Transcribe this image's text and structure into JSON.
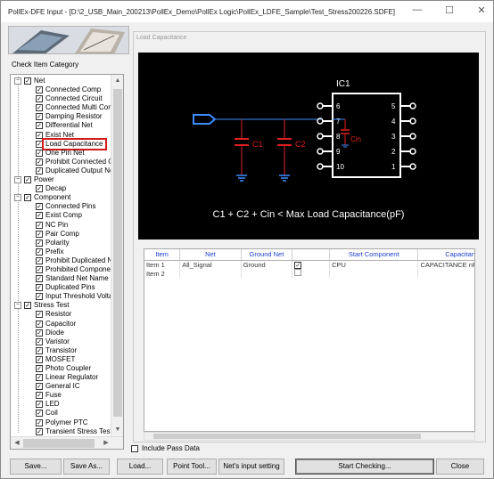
{
  "window": {
    "title": "PollEx-DFE Input - [D:\\2_USB_Main_200213\\PollEx_Demo\\PollEx Logic\\PollEx_LDFE_Sample\\Test_Stress200226.SDFE]",
    "minimize": "—",
    "maximize": "☐",
    "close": "✕"
  },
  "left_panel": {
    "category_label": "Check Item Category",
    "tree": [
      {
        "type": "group",
        "label": "Net",
        "checked": true
      },
      {
        "type": "item",
        "label": "Connected Comp",
        "checked": true
      },
      {
        "type": "item",
        "label": "Connected Circuit",
        "checked": true
      },
      {
        "type": "item",
        "label": "Connected Multi Comp",
        "checked": true
      },
      {
        "type": "item",
        "label": "Damping Resistor",
        "checked": true
      },
      {
        "type": "item",
        "label": "Differential Net",
        "checked": true
      },
      {
        "type": "item",
        "label": "Exist Net",
        "checked": true
      },
      {
        "type": "item",
        "label": "Load Capacitance",
        "checked": true,
        "selected": true
      },
      {
        "type": "item",
        "label": "One Pin Net",
        "checked": true
      },
      {
        "type": "item",
        "label": "Prohibit Connected Comp",
        "checked": true
      },
      {
        "type": "item",
        "label": "Duplicated Output Net",
        "checked": true
      },
      {
        "type": "group",
        "label": "Power",
        "checked": true
      },
      {
        "type": "item",
        "label": "Decap",
        "checked": true
      },
      {
        "type": "group",
        "label": "Component",
        "checked": true
      },
      {
        "type": "item",
        "label": "Connected Pins",
        "checked": true
      },
      {
        "type": "item",
        "label": "Exist Comp",
        "checked": true
      },
      {
        "type": "item",
        "label": "NC Pin",
        "checked": true
      },
      {
        "type": "item",
        "label": "Pair Comp",
        "checked": true
      },
      {
        "type": "item",
        "label": "Polarity",
        "checked": true
      },
      {
        "type": "item",
        "label": "Prefix",
        "checked": true
      },
      {
        "type": "item",
        "label": "Prohibit Duplicated Net",
        "checked": true
      },
      {
        "type": "item",
        "label": "Prohibited Component",
        "checked": true
      },
      {
        "type": "item",
        "label": "Standard Net Name",
        "checked": true
      },
      {
        "type": "item",
        "label": "Duplicated Pins",
        "checked": true
      },
      {
        "type": "item",
        "label": "Input Threshold Voltage",
        "checked": true
      },
      {
        "type": "group",
        "label": "Stress Test",
        "checked": true
      },
      {
        "type": "item",
        "label": "Resistor",
        "checked": true
      },
      {
        "type": "item",
        "label": "Capacitor",
        "checked": true
      },
      {
        "type": "item",
        "label": "Diode",
        "checked": true
      },
      {
        "type": "item",
        "label": "Varistor",
        "checked": true
      },
      {
        "type": "item",
        "label": "Transistor",
        "checked": true
      },
      {
        "type": "item",
        "label": "MOSFET",
        "checked": true
      },
      {
        "type": "item",
        "label": "Photo Coupler",
        "checked": true
      },
      {
        "type": "item",
        "label": "Linear Regulator",
        "checked": true
      },
      {
        "type": "item",
        "label": "General IC",
        "checked": true
      },
      {
        "type": "item",
        "label": "Fuse",
        "checked": true
      },
      {
        "type": "item",
        "label": "LED",
        "checked": true
      },
      {
        "type": "item",
        "label": "Coil",
        "checked": true
      },
      {
        "type": "item",
        "label": "Polymer PTC",
        "checked": true
      },
      {
        "type": "item",
        "label": "Transient Stress Test",
        "checked": true
      }
    ]
  },
  "right_panel": {
    "group_title": "Load Capacitance",
    "diagram": {
      "ic_label": "IC1",
      "c1_label": "C1",
      "c2_label": "C2",
      "cin_label": "Cin",
      "left_pins": [
        "6",
        "7",
        "8",
        "9",
        "10"
      ],
      "right_pins": [
        "5",
        "4",
        "3",
        "2",
        "1"
      ],
      "formula": "C1 + C2 + Cin < Max Load Capacitance(pF)",
      "colors": {
        "wire": "#3c8cff",
        "cap": "#e02020",
        "ic": "#ffffff",
        "background": "#000000"
      }
    },
    "grid": {
      "columns": [
        "Item",
        "Net",
        "Ground Net",
        "",
        "Start Component",
        "Capacitance Value Pr"
      ],
      "rows": [
        {
          "item": "Item 1",
          "net": "All_Signal",
          "ground": "Ground",
          "checked": "✓",
          "start": "CPU",
          "cap": "CAPACITANCE nF, Capa"
        },
        {
          "item": "Item 2",
          "net": "",
          "ground": "",
          "checked": "",
          "start": "",
          "cap": ""
        }
      ]
    },
    "include_pass_data": "Include Pass Data"
  },
  "buttons": {
    "save": "Save...",
    "save_as": "Save As...",
    "load": "Load...",
    "point_tool": "Point Tool...",
    "nets_input": "Net's input setting",
    "start_checking": "Start Checking...",
    "close": "Close"
  }
}
